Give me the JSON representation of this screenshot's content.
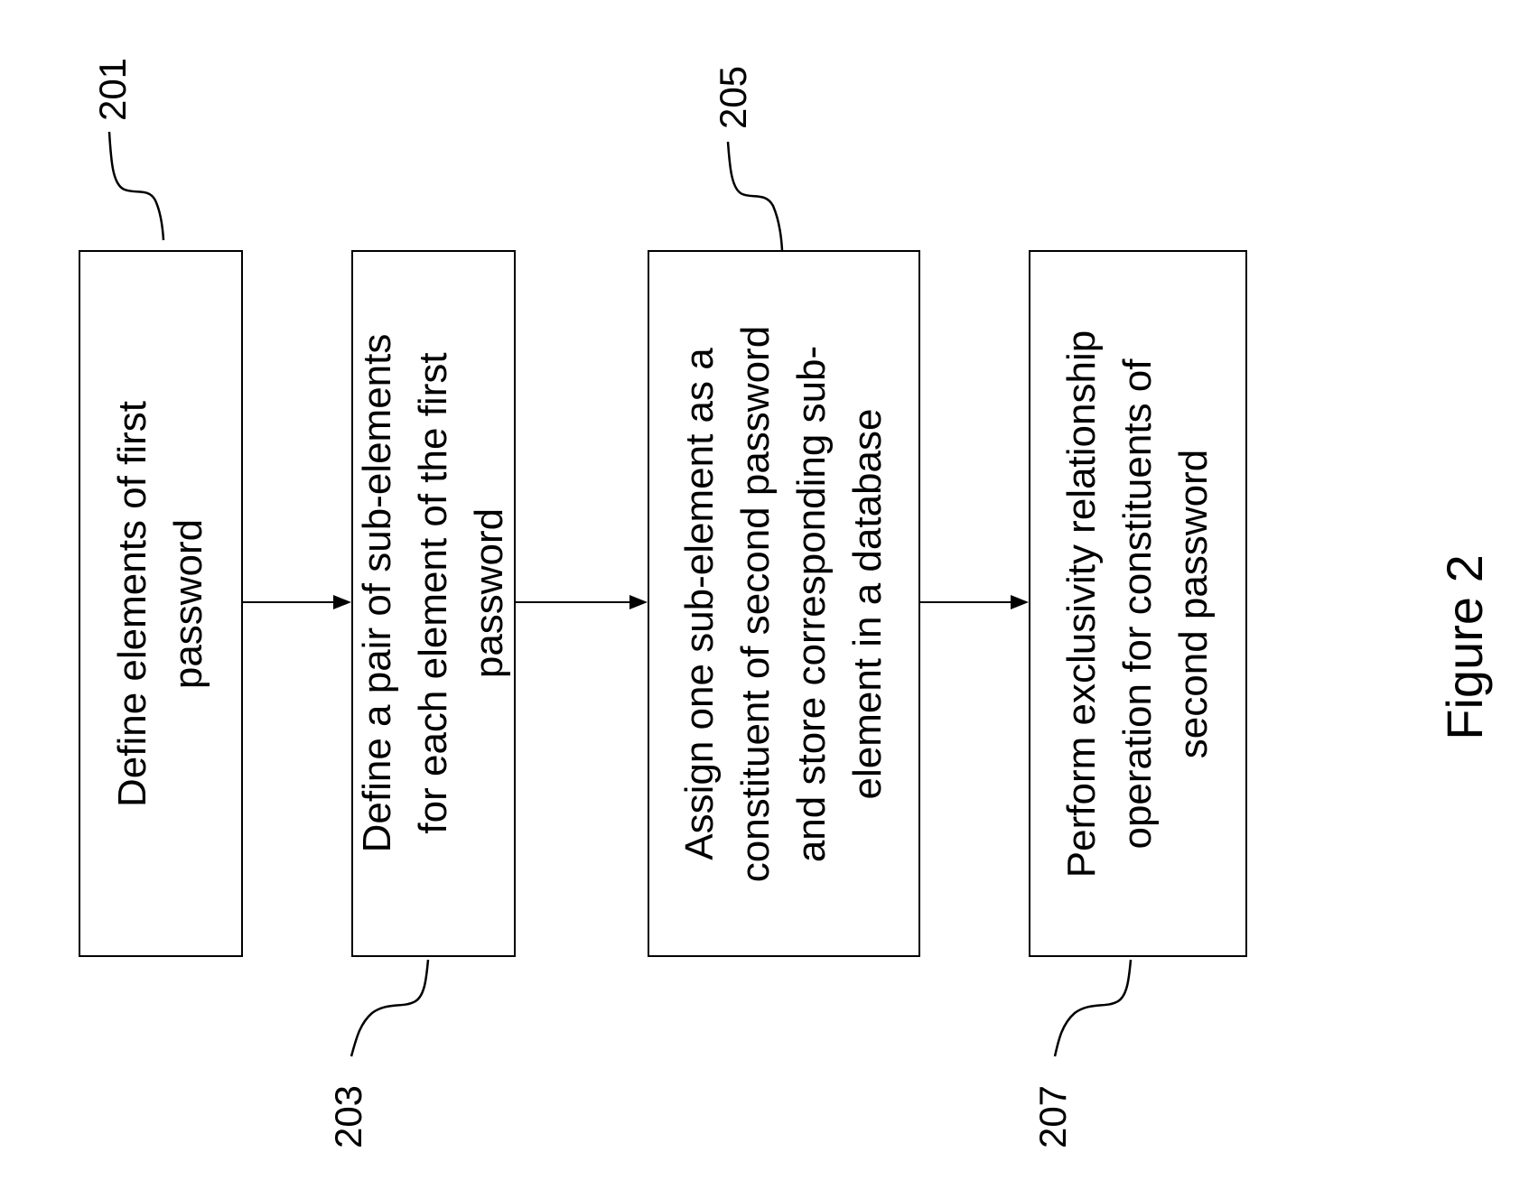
{
  "figure": {
    "caption": "Figure 2",
    "steps": [
      {
        "ref": "201",
        "lines": [
          "Define elements of first",
          "password"
        ]
      },
      {
        "ref": "203",
        "lines": [
          "Define a pair of sub-elements",
          "for each element of the first",
          "password"
        ]
      },
      {
        "ref": "205",
        "lines": [
          "Assign one sub-element as a",
          "constituent of second password",
          "and store corresponding sub-",
          "element in a database"
        ]
      },
      {
        "ref": "207",
        "lines": [
          "Perform exclusivity relationship",
          "operation for constituents of",
          "second password"
        ]
      }
    ],
    "flow_direction": "left-to-right",
    "line_color": "#000000",
    "background_color": "#ffffff"
  }
}
